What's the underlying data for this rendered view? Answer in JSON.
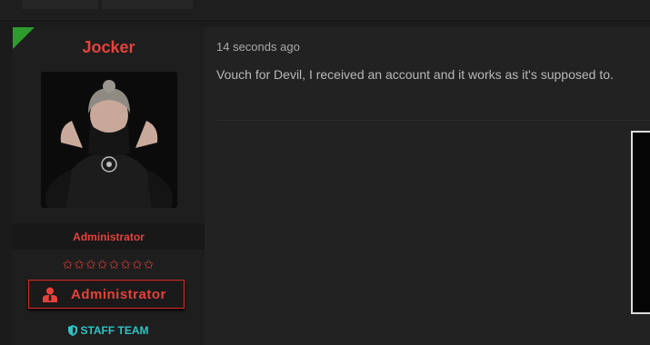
{
  "post": {
    "username": "Jocker",
    "user_title": "Administrator",
    "stars": "✩✩✩✩✩✩✩✩",
    "banner_label": "Administrator",
    "staff_label": "STAFF TEAM",
    "date": "14 seconds ago",
    "message": "Vouch for Devil, I received an account and it works as it's supposed to."
  },
  "colors": {
    "username": "#e5423b",
    "staff": "#2ec4c4",
    "corner_ribbon": "#2e9b2e",
    "background": "#222222"
  },
  "icons": {
    "banner": "user-icon",
    "staff": "shield-icon"
  }
}
